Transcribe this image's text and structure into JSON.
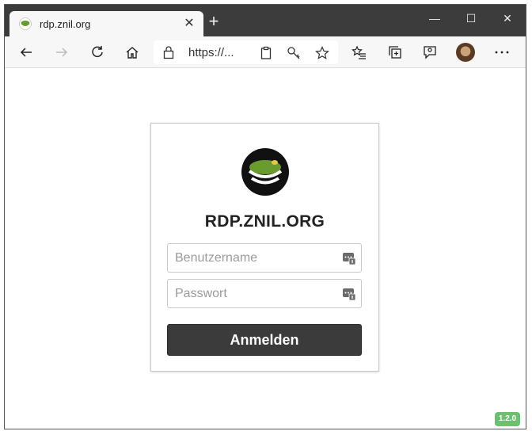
{
  "tab": {
    "title": "rdp.znil.org",
    "close_glyph": "✕"
  },
  "new_tab_glyph": "+",
  "window_controls": {
    "minimize": "—",
    "maximize": "☐",
    "close": "✕"
  },
  "address": {
    "url": "https://..."
  },
  "login": {
    "title": "RDP.ZNIL.ORG",
    "username_placeholder": "Benutzername",
    "password_placeholder": "Passwort",
    "submit_label": "Anmelden"
  },
  "version": "1.2.0",
  "colors": {
    "titlebar": "#3c3c3c",
    "toolbar": "#f7f7f7",
    "logo_green": "#6a9b2f",
    "button": "#3b3b3b",
    "version_badge": "#6fbf73"
  }
}
